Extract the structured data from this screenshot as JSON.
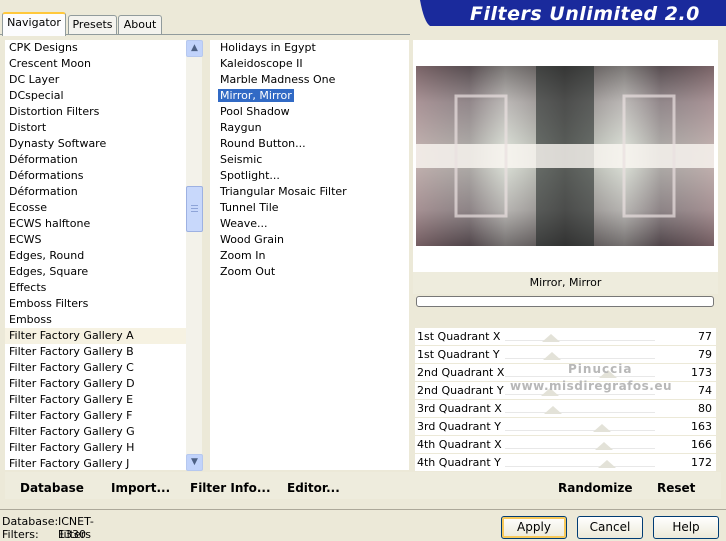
{
  "window_title": "Filters Unlimited 2.0",
  "tabs": [
    "Navigator",
    "Presets",
    "About"
  ],
  "categories": [
    "CPK Designs",
    "Crescent Moon",
    "DC Layer",
    "DCspecial",
    "Distortion Filters",
    "Distort",
    "Dynasty Software",
    "Déformation",
    "Déformations",
    "Déformation",
    "Ecosse",
    "ECWS halftone",
    "ECWS",
    "Edges, Round",
    "Edges, Square",
    "Effects",
    "Emboss Filters",
    "Emboss",
    "Filter Factory Gallery A",
    "Filter Factory Gallery B",
    "Filter Factory Gallery C",
    "Filter Factory Gallery D",
    "Filter Factory Gallery E",
    "Filter Factory Gallery F",
    "Filter Factory Gallery G",
    "Filter Factory Gallery H",
    "Filter Factory Gallery J"
  ],
  "selected_category": "Filter Factory Gallery A",
  "filters": [
    "Holidays in Egypt",
    "Kaleidoscope II",
    "Marble Madness One",
    "Mirror, Mirror",
    "Pool Shadow",
    "Raygun",
    "Round Button...",
    "Seismic",
    "Spotlight...",
    "Triangular Mosaic Filter",
    "Tunnel Tile",
    "Weave...",
    "Wood Grain",
    "Zoom In",
    "Zoom Out"
  ],
  "selected_filter": "Mirror, Mirror",
  "preview_caption": "Mirror, Mirror",
  "watermark": {
    "line1": "Pinuccia",
    "line2": "www.misdiregrafos.eu"
  },
  "parameters": [
    {
      "label": "1st Quadrant X",
      "value": 77
    },
    {
      "label": "1st Quadrant Y",
      "value": 79
    },
    {
      "label": "2nd Quadrant X",
      "value": 173
    },
    {
      "label": "2nd Quadrant Y",
      "value": 74
    },
    {
      "label": "3rd Quadrant X",
      "value": 80
    },
    {
      "label": "3rd Quadrant Y",
      "value": 163
    },
    {
      "label": "4th Quadrant X",
      "value": 166
    },
    {
      "label": "4th Quadrant Y",
      "value": 172
    }
  ],
  "toolbar": {
    "database": "Database",
    "import": "Import...",
    "filter_info": "Filter Info...",
    "editor": "Editor...",
    "randomize": "Randomize",
    "reset": "Reset"
  },
  "status": {
    "database_label": "Database:",
    "database_value": "ICNET-Filters",
    "filters_label": "Filters:",
    "filters_value": "1330"
  },
  "buttons": {
    "apply": "Apply",
    "cancel": "Cancel",
    "help": "Help"
  },
  "colors": {
    "title_banner": "#1a2a9c",
    "selection": "#316ac5",
    "window_bg": "#ece9d8"
  }
}
